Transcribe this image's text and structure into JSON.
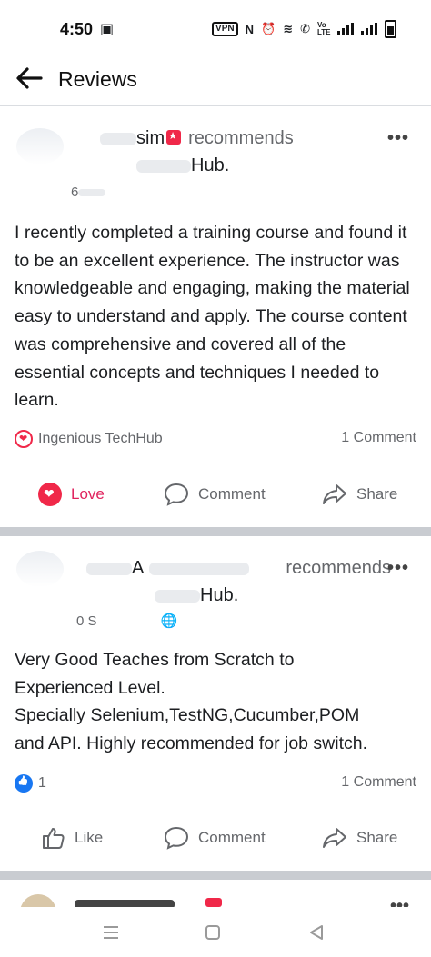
{
  "status_bar": {
    "time": "4:50",
    "vpn": "VPN",
    "lte": "Vo LTE"
  },
  "header": {
    "title": "Reviews"
  },
  "posts": [
    {
      "author_visible": "sim",
      "recommends": "recommends",
      "page_visible": "Hub.",
      "date_visible": "6",
      "text": "I recently completed a training course and found it to be an excellent experience. The instructor was knowledgeable and engaging, making the material easy to understand and apply. The course content was comprehensive and covered all of the essential concepts and techniques I needed to learn.",
      "reaction_label": "Ingenious TechHub",
      "comments": "1 Comment",
      "actions": {
        "love": "Love",
        "comment": "Comment",
        "share": "Share"
      }
    },
    {
      "author_visible": "A",
      "recommends": "recommends",
      "page_visible": "Hub.",
      "date_visible": "0 S",
      "text_lines": [
        "Very Good Teaches from Scratch to",
        "Experienced Level.",
        "Specially Selenium,TestNG,Cucumber,POM",
        "and API. Highly recommended for job switch."
      ],
      "reaction_count": "1",
      "comments": "1 Comment",
      "actions": {
        "like": "Like",
        "comment": "Comment",
        "share": "Share"
      }
    }
  ],
  "colors": {
    "love": "#f02849",
    "like": "#1877f2",
    "muted": "#65676b",
    "separator": "#c9ccd1"
  }
}
